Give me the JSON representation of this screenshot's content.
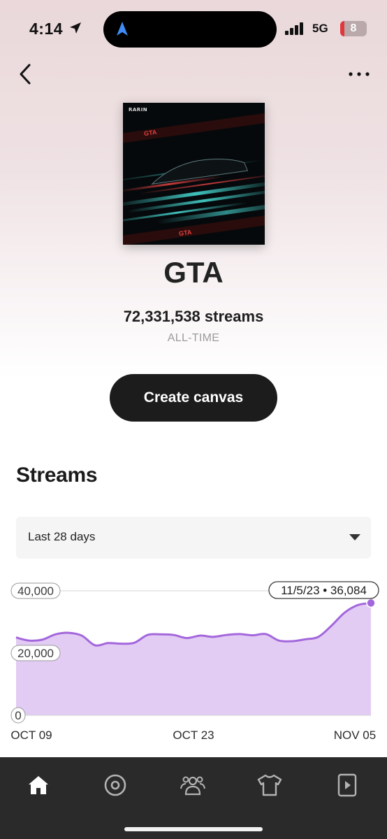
{
  "status_bar": {
    "time": "4:14",
    "network": "5G",
    "battery": "8"
  },
  "track": {
    "art_label": "RARIN",
    "art_text": "GTA",
    "title": "GTA",
    "streams_total": "72,331,538 streams",
    "streams_period": "ALL-TIME"
  },
  "actions": {
    "create_canvas": "Create canvas"
  },
  "streams_section": {
    "title": "Streams",
    "range_selected": "Last 28 days"
  },
  "chart_data": {
    "type": "area",
    "x_labels": [
      "OCT 09",
      "OCT 23",
      "NOV 05"
    ],
    "y_ticks": [
      "0",
      "20,000",
      "40,000"
    ],
    "ylim": [
      0,
      40000
    ],
    "tooltip": "11/5/23 • 36,084",
    "series_color": "#a367dc",
    "fill_color": "#e3ccf4",
    "x": [
      "10/9",
      "10/10",
      "10/11",
      "10/12",
      "10/13",
      "10/14",
      "10/15",
      "10/16",
      "10/17",
      "10/18",
      "10/19",
      "10/20",
      "10/21",
      "10/22",
      "10/23",
      "10/24",
      "10/25",
      "10/26",
      "10/27",
      "10/28",
      "10/29",
      "10/30",
      "10/31",
      "11/1",
      "11/2",
      "11/3",
      "11/4",
      "11/5"
    ],
    "values": [
      25000,
      24000,
      24300,
      26000,
      26500,
      25600,
      22500,
      23200,
      23000,
      23300,
      25800,
      26000,
      25800,
      24800,
      25600,
      25200,
      25800,
      26100,
      25700,
      26100,
      24000,
      23800,
      24400,
      25200,
      28800,
      33000,
      35400,
      36084
    ]
  },
  "bottom_nav": {
    "items": [
      {
        "name": "home",
        "active": true
      },
      {
        "name": "music",
        "active": false
      },
      {
        "name": "audience",
        "active": false
      },
      {
        "name": "merch",
        "active": false
      },
      {
        "name": "video",
        "active": false
      }
    ]
  }
}
